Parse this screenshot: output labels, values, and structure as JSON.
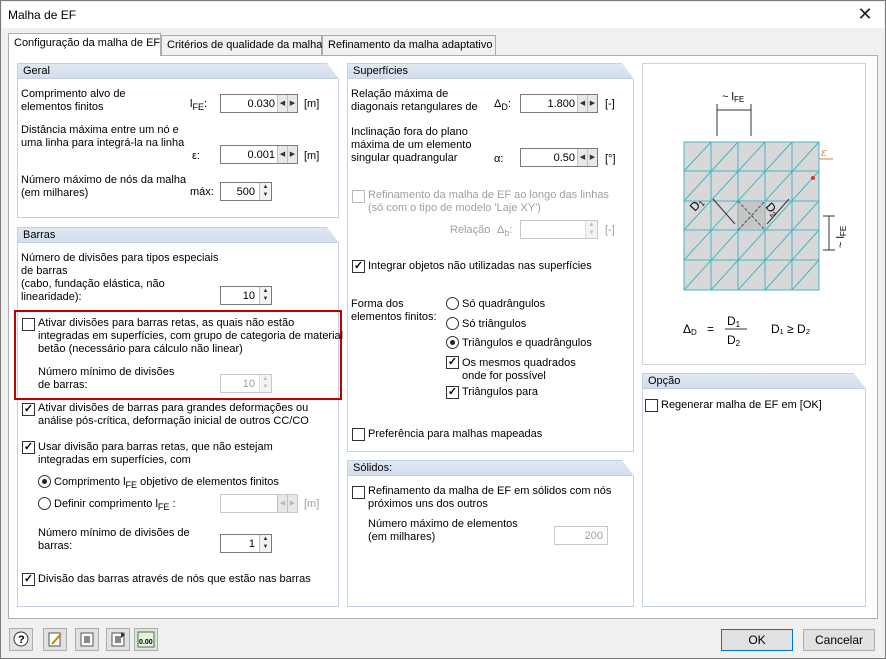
{
  "window": {
    "title": "Malha de EF"
  },
  "tabs": [
    "Configuração da malha de EF",
    "Critérios de qualidade da malha",
    "Refinamento da malha adaptativo"
  ],
  "geral": {
    "header": "Geral",
    "target_length_label": "Comprimento alvo de\nelementos finitos",
    "target_length_symbol": "l",
    "target_length_sub": "FE",
    "target_length_value": "0.030",
    "target_length_unit": "[m]",
    "max_distance_label": "Distância máxima entre um nó e\numa linha para integrá-la na linha",
    "max_distance_symbol": "ε:",
    "max_distance_value": "0.001",
    "max_distance_unit": "[m]",
    "max_nodes_label": "Número máximo de nós da malha\n(em milhares)",
    "max_nodes_symbol": "máx:",
    "max_nodes_value": "500"
  },
  "barras": {
    "header": "Barras",
    "divisions_label": "Número de divisões para tipos especiais\nde barras\n(cabo, fundação elástica, não\nlinearidade):",
    "divisions_value": "10",
    "activate_straight_label": "Ativar divisões para barras retas, as quais não estão\nintegradas em superfícies, com grupo de categoria de material\nbetão (necessário para cálculo não linear)",
    "activate_straight_checked": false,
    "min_divisions_label": "Número mínimo de divisões\nde barras:",
    "min_divisions_value": "10",
    "large_deform_label": "Ativar divisões de barras para grandes deformações ou\nanálise pós-crítica, deformação inicial de outros CC/CO",
    "large_deform_checked": true,
    "use_division_label": "Usar divisão para barras retas, que não estejam\nintegradas em superfícies, com",
    "use_division_checked": true,
    "radio_length_pre": "Comprimento l",
    "radio_length_sub": "FE",
    "radio_length_post": " objetivo de elementos finitos",
    "radio_define_pre": "Definir comprimento l",
    "radio_define_sub": "FE",
    "radio_define_post": " :",
    "define_unit": "[m]",
    "min_div2_label": "Número mínimo de divisões de\nbarras:",
    "min_div2_value": "1",
    "nodes_division_label": "Divisão das barras através de nós que estão nas barras",
    "nodes_division_checked": true
  },
  "superficies": {
    "header": "Superfícies",
    "ratio_label": "Relação máxima de\ndiagonais retangulares de",
    "ratio_symbol": "Δ",
    "ratio_sub": "D",
    "ratio_value": "1.800",
    "ratio_unit": "[-]",
    "incl_label": "Inclinação fora do plano\nmáxima de um elemento\nsingular quadrangular",
    "incl_symbol": "α:",
    "incl_value": "0.50",
    "incl_unit": "[°]",
    "refine_lines_label": "Refinamento da malha de EF ao longo das linhas\n(só com o tipo de modelo 'Laje XY')",
    "relation_label": "Relação",
    "relation_symbol": "Δ",
    "relation_sub": "b",
    "relation_unit": "[-]",
    "integrate_label": "Integrar objetos não utilizadas nas superfícies",
    "integrate_checked": true,
    "shape_label": "Forma dos\nelementos finitos:",
    "shape_options": [
      "Só quadrângulos",
      "Só triângulos",
      "Triângulos e quadrângulos"
    ],
    "shape_selected": 2,
    "same_squares_label": "Os mesmos quadrados\nonde for possível",
    "triangles_for_label": "Triângulos para",
    "mapped_label": "Preferência para malhas mapeadas"
  },
  "solidos": {
    "header": "Sólidos:",
    "refine_label": "Refinamento da malha de EF em sólidos com nós\npróximos uns dos outros",
    "max_elem_label": "Número máximo de elementos\n(em milhares)",
    "max_elem_value": "200"
  },
  "diagram": {
    "lfe_label": "~ l",
    "lfe_sub": "FE",
    "d1": "D",
    "d1_sub": "1",
    "d2": "D",
    "d2_sub": "2",
    "eps": "ε",
    "formula_lhs": "Δ",
    "formula_lhs_sub": "D",
    "formula_eq": "=",
    "formula_condition": "D₁ ≥ D₂",
    "mesh_color": "#46b4c8",
    "accent_color": "#e08020"
  },
  "opcao": {
    "header": "Opção",
    "regen_label": "Regenerar malha de EF em [OK]"
  },
  "buttons": {
    "ok": "OK",
    "cancel": "Cancelar"
  },
  "toolbar_icons": [
    "help-icon",
    "edit-icon",
    "import-icon",
    "export-icon",
    "units-icon"
  ],
  "toolbar_units_text": "0.00"
}
